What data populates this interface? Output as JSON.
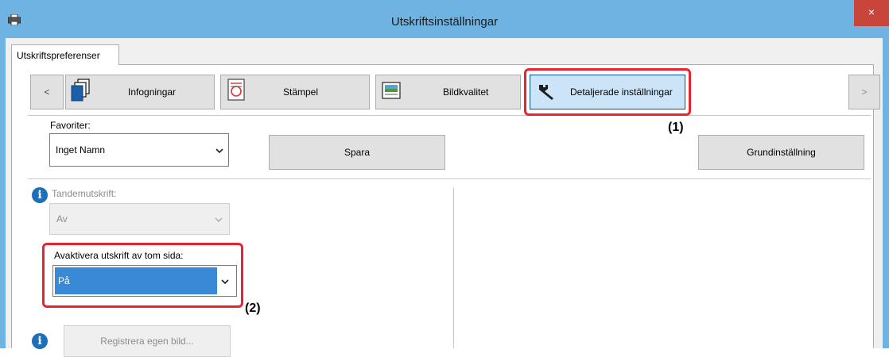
{
  "window": {
    "title": "Utskriftsinställningar",
    "close_glyph": "×",
    "app_icon": "printer-icon"
  },
  "tabs": [
    {
      "label": "Utskriftspreferenser",
      "selected": true
    }
  ],
  "toolbar": {
    "prev_label": "<",
    "next_label": ">",
    "buttons": [
      {
        "label": "Infogningar",
        "icon": "pages-icon"
      },
      {
        "label": "Stämpel",
        "icon": "stamp-icon"
      },
      {
        "label": "Bildkvalitet",
        "icon": "image-quality-icon"
      },
      {
        "label": "Detaljerade inställningar",
        "icon": "wrench-icon",
        "selected": true
      }
    ]
  },
  "favorites": {
    "label": "Favoriter:",
    "value": "Inget Namn",
    "save_label": "Spara",
    "default_label": "Grundinställning"
  },
  "tandem": {
    "label": "Tandemutskrift:",
    "value": "Av",
    "enabled": false
  },
  "blank_page": {
    "label": "Avaktivera utskrift av tom sida:",
    "value": "På"
  },
  "register": {
    "label": "Registrera egen bild...",
    "enabled": false
  },
  "callouts": [
    "(1)",
    "(2)"
  ],
  "colors": {
    "titlebar": "#6fb3e3",
    "callout": "#e8252e",
    "selection": "#3a89d6",
    "info": "#1d6fb8"
  }
}
